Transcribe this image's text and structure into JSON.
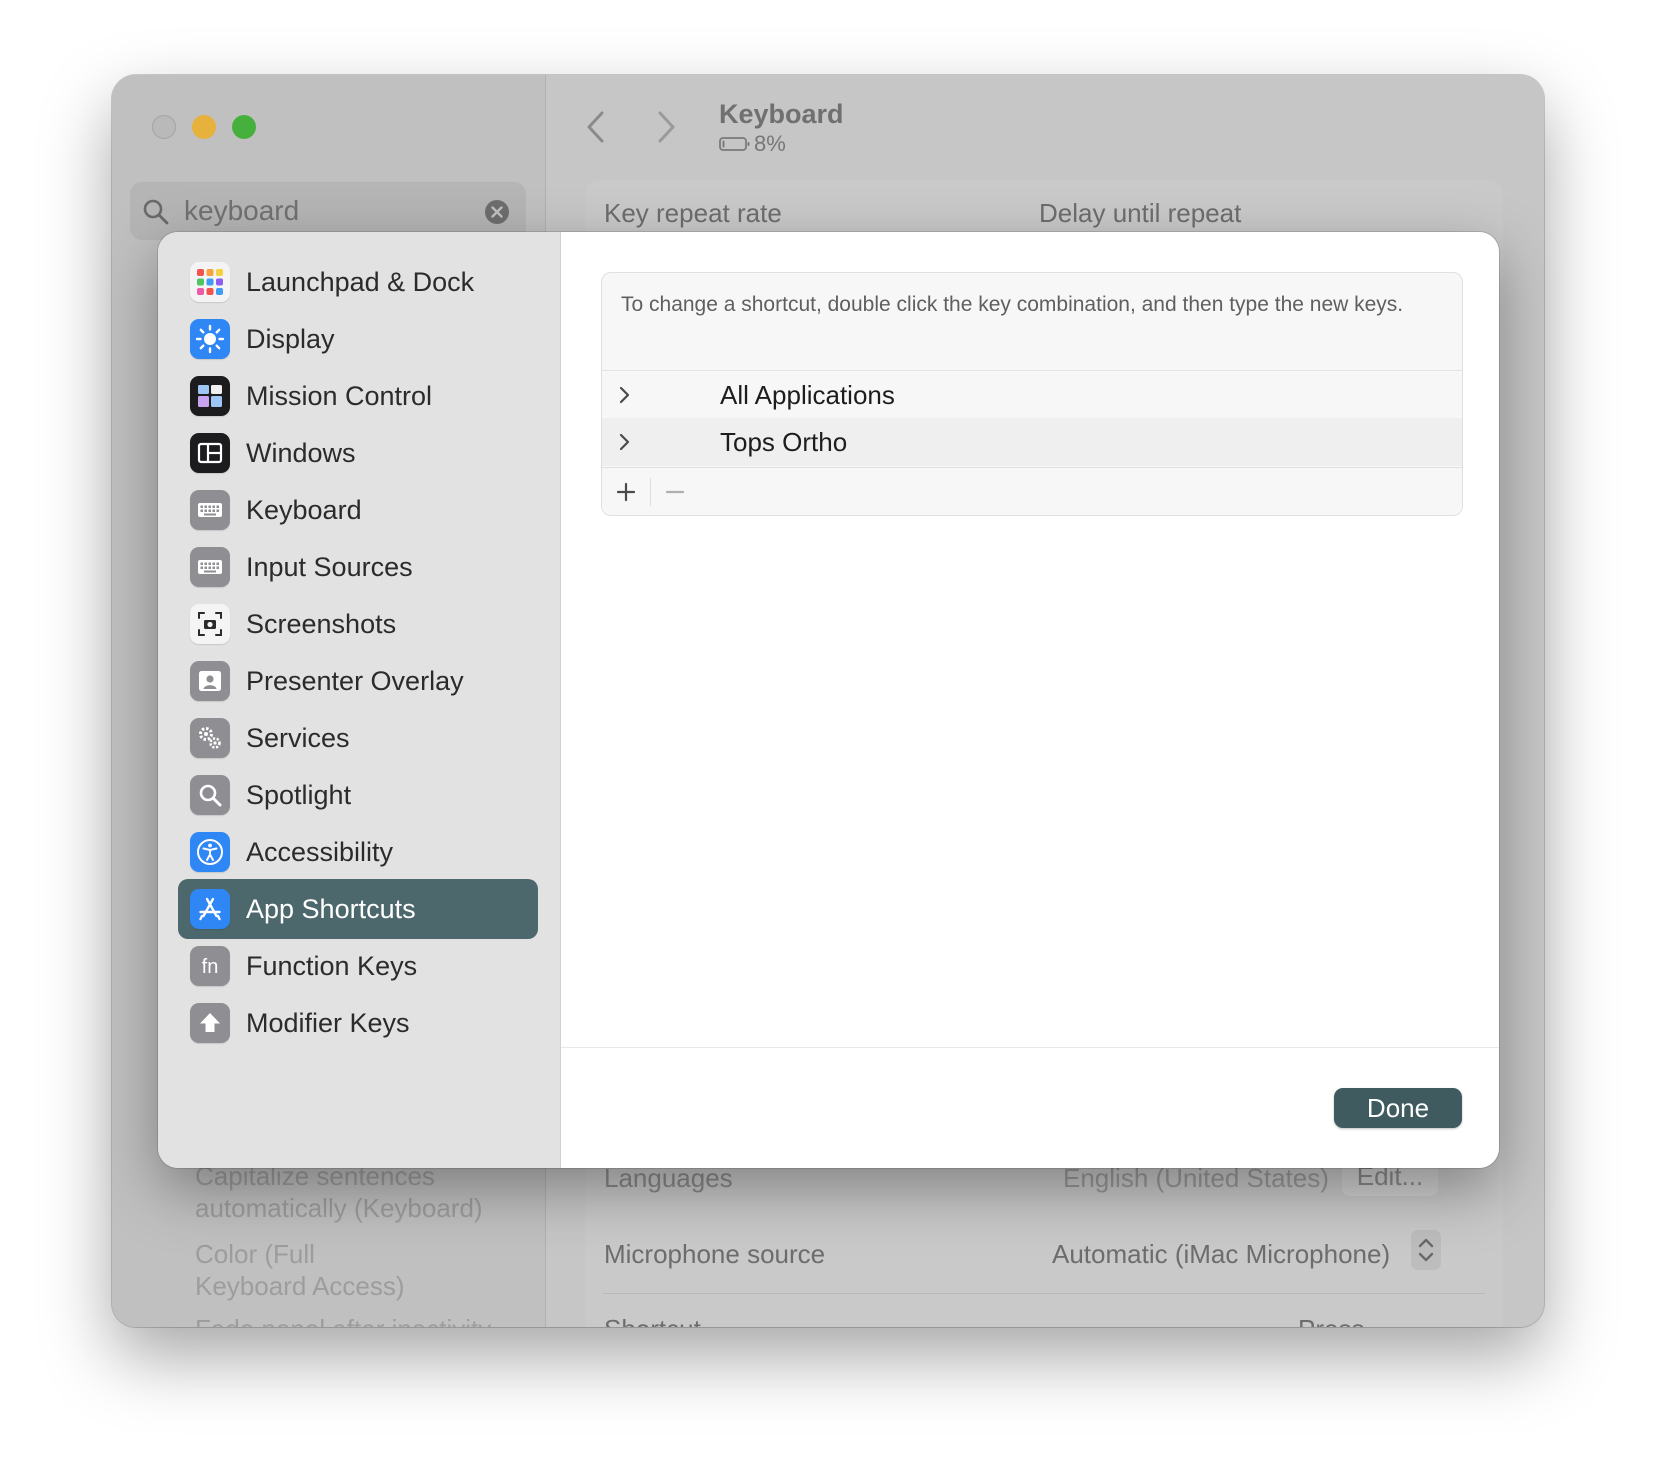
{
  "window": {
    "title": "Keyboard",
    "battery": "8%",
    "search": {
      "value": "keyboard"
    }
  },
  "background": {
    "key_repeat_rate": "Key repeat rate",
    "delay_until_repeat": "Delay until repeat",
    "languages_label": "Languages",
    "languages_value": "English (United States)",
    "edit_button": "Edit...",
    "microphone_source_label": "Microphone source",
    "microphone_source_value": "Automatic (iMac Microphone)",
    "shortcut_label": "Shortcut",
    "shortcut_value": "Press",
    "sidebar_results": [
      "Capitalize sentences",
      "automatically (Keyboard)",
      "Color (Full",
      "Keyboard Access)",
      "Fade panel after inactivity"
    ]
  },
  "sheet": {
    "sidebar": {
      "items": [
        {
          "label": "Launchpad & Dock",
          "icon": "launchpad-dock-icon"
        },
        {
          "label": "Display",
          "icon": "display-icon"
        },
        {
          "label": "Mission Control",
          "icon": "mission-control-icon"
        },
        {
          "label": "Windows",
          "icon": "windows-icon"
        },
        {
          "label": "Keyboard",
          "icon": "keyboard-icon"
        },
        {
          "label": "Input Sources",
          "icon": "input-sources-icon"
        },
        {
          "label": "Screenshots",
          "icon": "screenshots-icon"
        },
        {
          "label": "Presenter Overlay",
          "icon": "presenter-overlay-icon"
        },
        {
          "label": "Services",
          "icon": "services-icon"
        },
        {
          "label": "Spotlight",
          "icon": "spotlight-icon"
        },
        {
          "label": "Accessibility",
          "icon": "accessibility-icon"
        },
        {
          "label": "App Shortcuts",
          "icon": "app-shortcuts-icon",
          "selected": true
        },
        {
          "label": "Function Keys",
          "icon": "function-keys-icon"
        },
        {
          "label": "Modifier Keys",
          "icon": "modifier-keys-icon"
        }
      ]
    },
    "content": {
      "description": "To change a shortcut, double click the key combination, and then type the new keys.",
      "rows": [
        {
          "label": "All Applications"
        },
        {
          "label": "Tops Ortho"
        }
      ],
      "add_symbol": "+",
      "remove_symbol": "−"
    },
    "done_label": "Done"
  },
  "colors": {
    "selection": "#4d686c",
    "done_button": "#3f5b60",
    "traffic_min": "#e7b23b",
    "traffic_max": "#46b03d"
  }
}
